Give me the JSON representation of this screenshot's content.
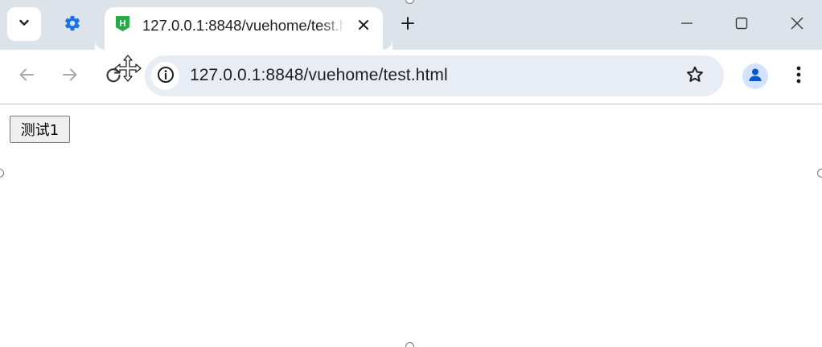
{
  "browser": {
    "tab": {
      "title": "127.0.0.1:8848/vuehome/test.html",
      "favicon_letter": "H",
      "favicon_color": "#2ba84a"
    },
    "address_bar": {
      "url": "127.0.0.1:8848/vuehome/test.html"
    },
    "icons": {
      "tab_search": "chevron-down-icon",
      "settings": "gear-icon",
      "tab_close": "close-icon",
      "new_tab": "plus-icon",
      "minimize": "minimize-icon",
      "maximize": "maximize-icon",
      "window_close": "close-icon",
      "back": "arrow-left-icon",
      "forward": "arrow-right-icon",
      "reload": "reload-icon",
      "site_info": "info-icon",
      "bookmark": "star-icon",
      "profile": "person-icon",
      "menu": "more-vertical-icon",
      "cursor": "move-cursor-icon"
    },
    "colors": {
      "tabstrip": "#dde3ea",
      "omnibox": "#e8edf5",
      "accent": "#1a73e8",
      "profile_bg": "#d3e3fd",
      "profile_fg": "#0b57d0"
    }
  },
  "page": {
    "button_label": "测试1"
  }
}
